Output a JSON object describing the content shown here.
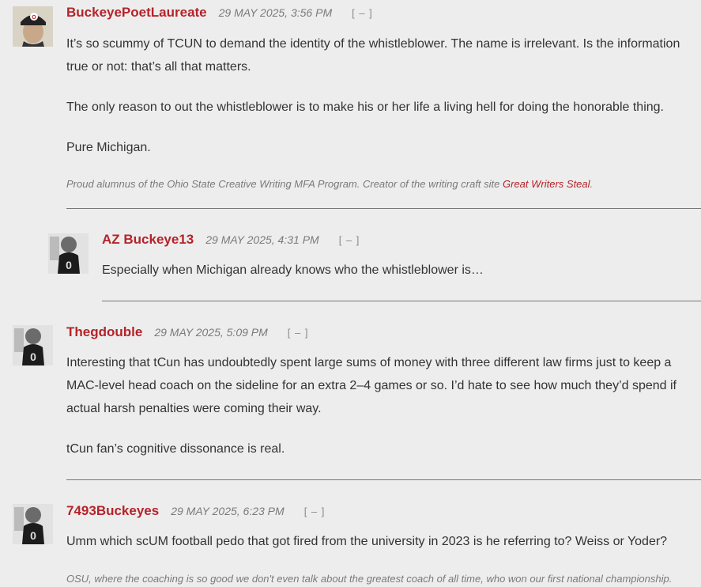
{
  "comments": [
    {
      "author": "BuckeyePoetLaureate",
      "date": "29 MAY 2025, 3:56 PM",
      "collapse": "[ – ]",
      "paragraphs": [
        "It’s so scummy of TCUN to demand the identity of the whistleblower.  The name is irrelevant.  Is the information true or not: that’s all that matters.",
        "The only reason to out the whistleblower is to make his or her life a living hell for doing the honorable thing.",
        "Pure Michigan."
      ],
      "signature_text": "Proud alumnus of the Ohio State Creative Writing MFA Program.  Creator of the writing craft site ",
      "signature_link": "Great Writers Steal",
      "signature_end": "."
    },
    {
      "author": "AZ Buckeye13",
      "date": "29 MAY 2025, 4:31 PM",
      "collapse": "[ – ]",
      "paragraphs": [
        "Especially when Michigan already knows who the whistleblower is…"
      ]
    },
    {
      "author": "Thegdouble",
      "date": "29 MAY 2025, 5:09 PM",
      "collapse": "[ – ]",
      "paragraphs": [
        "Interesting that tCun has undoubtedly spent large sums of money with three different law firms just to keep a MAC-level head coach on the sideline for an extra 2–4 games or so. I’d hate to see how much they’d spend if actual harsh penalties were coming their way.",
        "tCun fan’s cognitive dissonance is real."
      ]
    },
    {
      "author": "7493Buckeyes",
      "date": "29 MAY 2025, 6:23 PM",
      "collapse": "[ – ]",
      "paragraphs": [
        "Umm which scUM football pedo that got fired from the university in 2023 is he referring to? Weiss or Yoder?"
      ],
      "signature_text": "OSU, where the coaching is so good we don't even talk about the greatest coach of all time, who won our first national championship."
    }
  ]
}
